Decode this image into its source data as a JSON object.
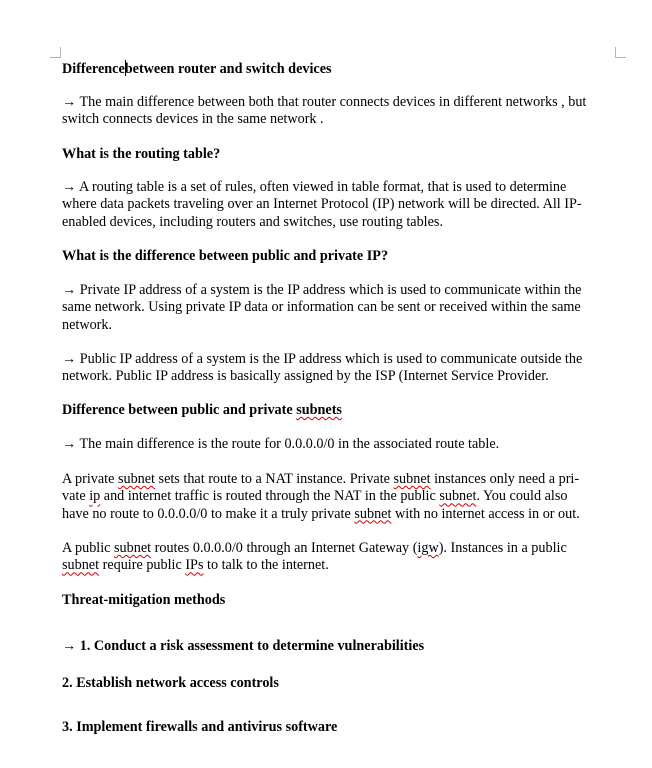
{
  "document": {
    "h1_part1": "Difference",
    "h1_part2": "between router and switch devices",
    "p1_line1": "→ The main difference between both that router connects devices in different networks , but",
    "p1_line2": "switch connects devices in the same network .",
    "h2": "What is the routing table?",
    "p2_line1": "→ A routing table is a set of rules, often viewed in table format, that is used to determine",
    "p2_line2": "where data packets traveling over an Internet Protocol (IP) network will be directed. All IP-",
    "p2_line3": "enabled devices, including routers and switches, use routing tables.",
    "h3": "What is the difference between public and private IP?",
    "p3_line1": "→ Private IP address of a system is the IP address which is used to communicate within the",
    "p3_line2": "same network. Using private IP data or information can be sent or received within the same",
    "p3_line3": "network.",
    "p4_line1": "→ Public IP address of a system is the IP address which is used to communicate outside the",
    "p4_line2": "network. Public IP address is basically assigned by the ISP (Internet Service Provider.",
    "h4_part1": "Difference between public and private ",
    "h4_part2": "subnets",
    "p5": "→ The main difference is the route for 0.0.0.0/0 in the associated route table.",
    "p6_l1_a": "A private ",
    "p6_l1_b": "subnet",
    "p6_l1_c": " sets that route to a NAT instance. Private ",
    "p6_l1_d": "subnet",
    "p6_l1_e": " instances only need a pri-",
    "p6_l2_a": "vate ",
    "p6_l2_b": "ip",
    "p6_l2_c": " and internet traffic is routed through the NAT in the public ",
    "p6_l2_d": "subnet",
    "p6_l2_e": ". You could also",
    "p6_l3_a": "have no route to 0.0.0.0/0 to make it a truly private ",
    "p6_l3_b": "subnet",
    "p6_l3_c": " with no internet access in or out.",
    "p7_l1_a": "A public ",
    "p7_l1_b": "subnet",
    "p7_l1_c": " routes 0.0.0.0/0 through an Internet Gateway (",
    "p7_l1_d": "igw",
    "p7_l1_e": "). Instances in a public",
    "p7_l2_a": "subnet",
    "p7_l2_b": " require public ",
    "p7_l2_c": "IPs",
    "p7_l2_d": " to talk to the internet.",
    "h5": "Threat-mitigation methods",
    "item1": "→   1. Conduct a risk assessment to determine vulnerabilities",
    "item2": "2. Establish network access controls",
    "item3": "3. Implement firewalls and antivirus software"
  }
}
